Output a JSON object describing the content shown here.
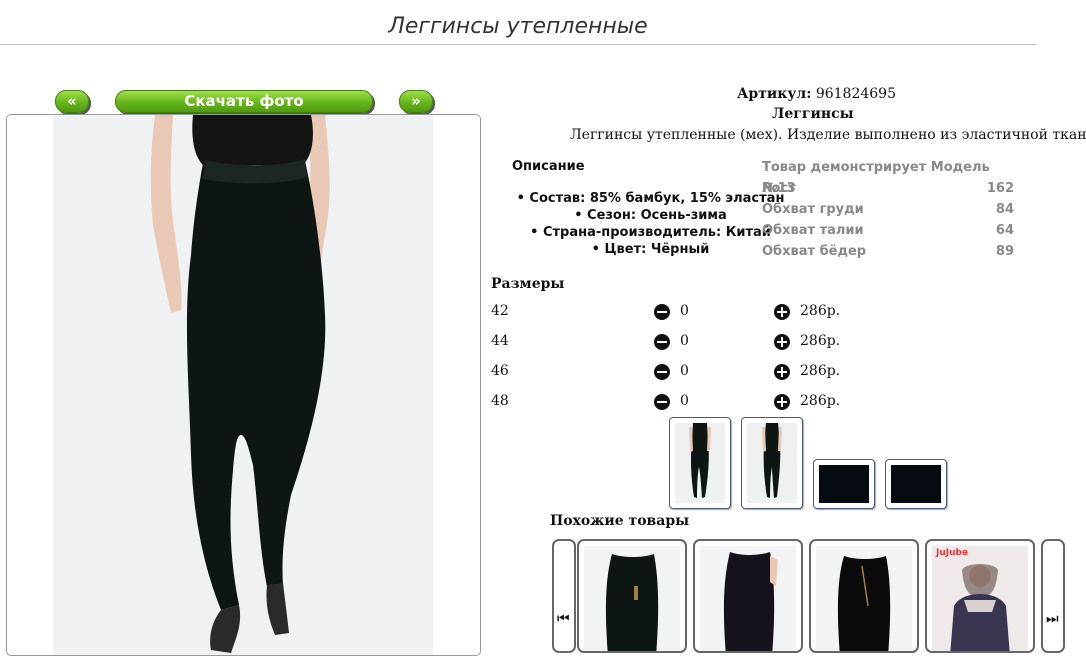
{
  "page": {
    "title": "Леггинсы утепленные"
  },
  "gallery": {
    "prev_label": "«",
    "download_label": "Скачать фото",
    "next_label": "»"
  },
  "product": {
    "sku_label": "Артикул:",
    "sku_value": "961824695",
    "name": "Леггинсы",
    "description": "Леггинсы утепленные (мех). Изделие выполнено из эластичной ткани"
  },
  "details": {
    "heading": "Описание",
    "items": [
      "• Состав: 85% бамбук, 15% эластан",
      "• Сезон: Осень-зима",
      "• Страна-производитель: Китай",
      "• Цвет: Чёрный"
    ]
  },
  "model": {
    "title": "Товар демонстрирует Модель №13",
    "rows": [
      {
        "label": "Рост",
        "value": "162"
      },
      {
        "label": "Обхват груди",
        "value": "84"
      },
      {
        "label": "Обхват талии",
        "value": "64"
      },
      {
        "label": "Обхват бёдер",
        "value": "89"
      }
    ]
  },
  "sizes": {
    "heading": "Размеры",
    "rows": [
      {
        "size": "42",
        "qty": "0",
        "price": "286р."
      },
      {
        "size": "44",
        "qty": "0",
        "price": "286р."
      },
      {
        "size": "46",
        "qty": "0",
        "price": "286р."
      },
      {
        "size": "48",
        "qty": "0",
        "price": "286р."
      }
    ]
  },
  "similar": {
    "heading": "Похожие товары",
    "prev_icon": "skip-previous-icon",
    "next_icon": "skip-next-icon",
    "brand_text": "JuJube"
  },
  "colors": {
    "button_green": "#66b51c",
    "garment_black": "#0d1612",
    "thumb_border": "#4a5b7a"
  }
}
